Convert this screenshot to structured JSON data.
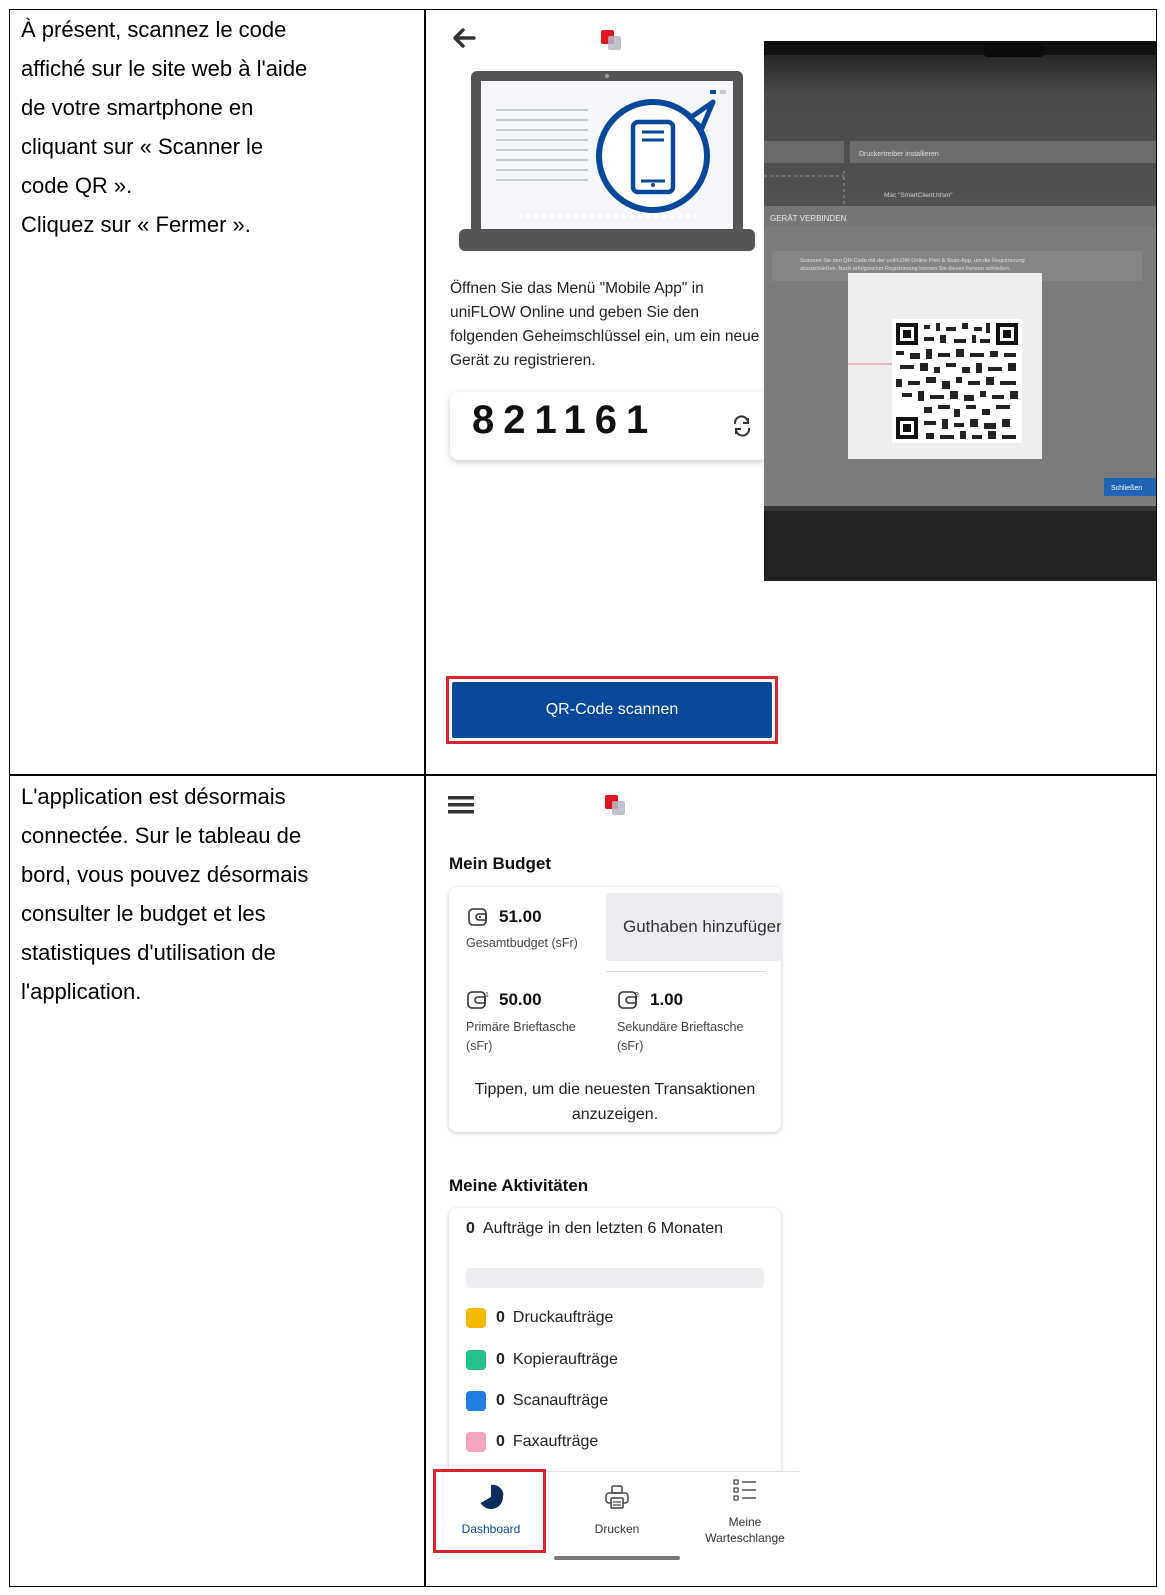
{
  "row1": {
    "instructions": [
      "À présent, scannez le code",
      "affiché sur le site web à l'aide",
      "de votre smartphone en",
      "cliquant sur « Scanner le",
      "code QR ».",
      "Cliquez sur « Fermer »."
    ],
    "app": {
      "instruction_lines": [
        "Öffnen Sie das Menü \"Mobile App\" in",
        "uniFLOW Online und geben Sie den",
        "folgenden Geheimschlüssel ein, um ein neue",
        "Gerät zu registrieren."
      ],
      "secret_code": "821161",
      "scan_button_label": "QR-Code scannen"
    },
    "photo": {
      "menu_item": "Druckertreiber installieren",
      "file_item": "Mac \"SmartClient.hfsm\"",
      "dialog_title": "GERÄT VERBINDEN",
      "dialog_info": "Scannen Sie den QR-Code mit der uniFLOW Online Print & Scan-App, um die Registrierung abzuschließen. Nach erfolgreicher Registrierung können Sie dieses Fenster schließen.",
      "close_button": "Schließen"
    }
  },
  "row2": {
    "instructions": [
      "L'application est désormais",
      "connectée. Sur le tableau de",
      "bord, vous pouvez désormais",
      "consulter le budget et les",
      "statistiques d'utilisation de",
      "l'application."
    ],
    "app": {
      "budget_title": "Mein Budget",
      "total_amount": "51.00",
      "total_label": "Gesamtbudget  (sFr)",
      "add_credit": "Guthaben hinzufügen",
      "primary_amount": "50.00",
      "primary_label_1": "Primäre Brieftasche",
      "primary_label_2": "(sFr)",
      "secondary_amount": "1.00",
      "secondary_label_1": "Sekundäre Brieftasche",
      "secondary_label_2": "(sFr)",
      "tap_hint_1": "Tippen, um die neuesten Transaktionen",
      "tap_hint_2": "anzuzeigen.",
      "activities_title": "Meine Aktivitäten",
      "jobs_count": "0",
      "jobs_label": "Aufträge in den letzten 6 Monaten",
      "job_progress": 0,
      "job_types": [
        {
          "count": "0",
          "label": "Druckaufträge",
          "color": "#f5b800"
        },
        {
          "count": "0",
          "label": "Kopieraufträge",
          "color": "#22c08a"
        },
        {
          "count": "0",
          "label": "Scanaufträge",
          "color": "#1f7ee0"
        },
        {
          "count": "0",
          "label": "Faxaufträge",
          "color": "#f5a3c0"
        }
      ],
      "nav": {
        "dashboard": "Dashboard",
        "print": "Drucken",
        "queue_1": "Meine",
        "queue_2": "Warteschlange"
      }
    }
  },
  "colors": {
    "brand_blue": "#08489a",
    "highlight_red": "#d9242b",
    "logo_red": "#e2141e"
  }
}
